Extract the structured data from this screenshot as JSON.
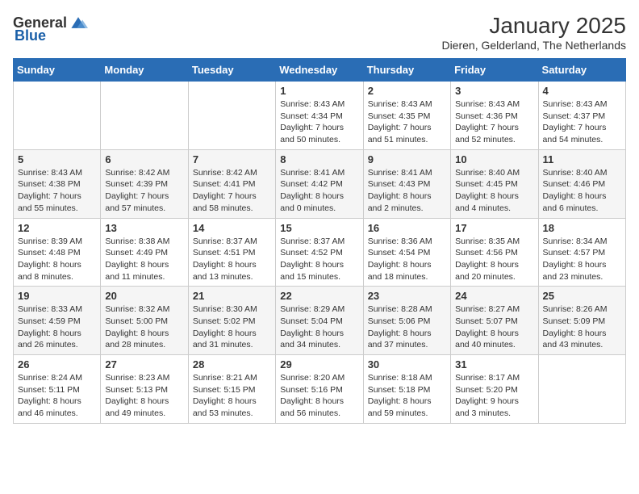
{
  "logo": {
    "general": "General",
    "blue": "Blue"
  },
  "header": {
    "month_year": "January 2025",
    "location": "Dieren, Gelderland, The Netherlands"
  },
  "weekdays": [
    "Sunday",
    "Monday",
    "Tuesday",
    "Wednesday",
    "Thursday",
    "Friday",
    "Saturday"
  ],
  "weeks": [
    [
      {
        "day": "",
        "info": ""
      },
      {
        "day": "",
        "info": ""
      },
      {
        "day": "",
        "info": ""
      },
      {
        "day": "1",
        "info": "Sunrise: 8:43 AM\nSunset: 4:34 PM\nDaylight: 7 hours\nand 50 minutes."
      },
      {
        "day": "2",
        "info": "Sunrise: 8:43 AM\nSunset: 4:35 PM\nDaylight: 7 hours\nand 51 minutes."
      },
      {
        "day": "3",
        "info": "Sunrise: 8:43 AM\nSunset: 4:36 PM\nDaylight: 7 hours\nand 52 minutes."
      },
      {
        "day": "4",
        "info": "Sunrise: 8:43 AM\nSunset: 4:37 PM\nDaylight: 7 hours\nand 54 minutes."
      }
    ],
    [
      {
        "day": "5",
        "info": "Sunrise: 8:43 AM\nSunset: 4:38 PM\nDaylight: 7 hours\nand 55 minutes."
      },
      {
        "day": "6",
        "info": "Sunrise: 8:42 AM\nSunset: 4:39 PM\nDaylight: 7 hours\nand 57 minutes."
      },
      {
        "day": "7",
        "info": "Sunrise: 8:42 AM\nSunset: 4:41 PM\nDaylight: 7 hours\nand 58 minutes."
      },
      {
        "day": "8",
        "info": "Sunrise: 8:41 AM\nSunset: 4:42 PM\nDaylight: 8 hours\nand 0 minutes."
      },
      {
        "day": "9",
        "info": "Sunrise: 8:41 AM\nSunset: 4:43 PM\nDaylight: 8 hours\nand 2 minutes."
      },
      {
        "day": "10",
        "info": "Sunrise: 8:40 AM\nSunset: 4:45 PM\nDaylight: 8 hours\nand 4 minutes."
      },
      {
        "day": "11",
        "info": "Sunrise: 8:40 AM\nSunset: 4:46 PM\nDaylight: 8 hours\nand 6 minutes."
      }
    ],
    [
      {
        "day": "12",
        "info": "Sunrise: 8:39 AM\nSunset: 4:48 PM\nDaylight: 8 hours\nand 8 minutes."
      },
      {
        "day": "13",
        "info": "Sunrise: 8:38 AM\nSunset: 4:49 PM\nDaylight: 8 hours\nand 11 minutes."
      },
      {
        "day": "14",
        "info": "Sunrise: 8:37 AM\nSunset: 4:51 PM\nDaylight: 8 hours\nand 13 minutes."
      },
      {
        "day": "15",
        "info": "Sunrise: 8:37 AM\nSunset: 4:52 PM\nDaylight: 8 hours\nand 15 minutes."
      },
      {
        "day": "16",
        "info": "Sunrise: 8:36 AM\nSunset: 4:54 PM\nDaylight: 8 hours\nand 18 minutes."
      },
      {
        "day": "17",
        "info": "Sunrise: 8:35 AM\nSunset: 4:56 PM\nDaylight: 8 hours\nand 20 minutes."
      },
      {
        "day": "18",
        "info": "Sunrise: 8:34 AM\nSunset: 4:57 PM\nDaylight: 8 hours\nand 23 minutes."
      }
    ],
    [
      {
        "day": "19",
        "info": "Sunrise: 8:33 AM\nSunset: 4:59 PM\nDaylight: 8 hours\nand 26 minutes."
      },
      {
        "day": "20",
        "info": "Sunrise: 8:32 AM\nSunset: 5:00 PM\nDaylight: 8 hours\nand 28 minutes."
      },
      {
        "day": "21",
        "info": "Sunrise: 8:30 AM\nSunset: 5:02 PM\nDaylight: 8 hours\nand 31 minutes."
      },
      {
        "day": "22",
        "info": "Sunrise: 8:29 AM\nSunset: 5:04 PM\nDaylight: 8 hours\nand 34 minutes."
      },
      {
        "day": "23",
        "info": "Sunrise: 8:28 AM\nSunset: 5:06 PM\nDaylight: 8 hours\nand 37 minutes."
      },
      {
        "day": "24",
        "info": "Sunrise: 8:27 AM\nSunset: 5:07 PM\nDaylight: 8 hours\nand 40 minutes."
      },
      {
        "day": "25",
        "info": "Sunrise: 8:26 AM\nSunset: 5:09 PM\nDaylight: 8 hours\nand 43 minutes."
      }
    ],
    [
      {
        "day": "26",
        "info": "Sunrise: 8:24 AM\nSunset: 5:11 PM\nDaylight: 8 hours\nand 46 minutes."
      },
      {
        "day": "27",
        "info": "Sunrise: 8:23 AM\nSunset: 5:13 PM\nDaylight: 8 hours\nand 49 minutes."
      },
      {
        "day": "28",
        "info": "Sunrise: 8:21 AM\nSunset: 5:15 PM\nDaylight: 8 hours\nand 53 minutes."
      },
      {
        "day": "29",
        "info": "Sunrise: 8:20 AM\nSunset: 5:16 PM\nDaylight: 8 hours\nand 56 minutes."
      },
      {
        "day": "30",
        "info": "Sunrise: 8:18 AM\nSunset: 5:18 PM\nDaylight: 8 hours\nand 59 minutes."
      },
      {
        "day": "31",
        "info": "Sunrise: 8:17 AM\nSunset: 5:20 PM\nDaylight: 9 hours\nand 3 minutes."
      },
      {
        "day": "",
        "info": ""
      }
    ]
  ]
}
